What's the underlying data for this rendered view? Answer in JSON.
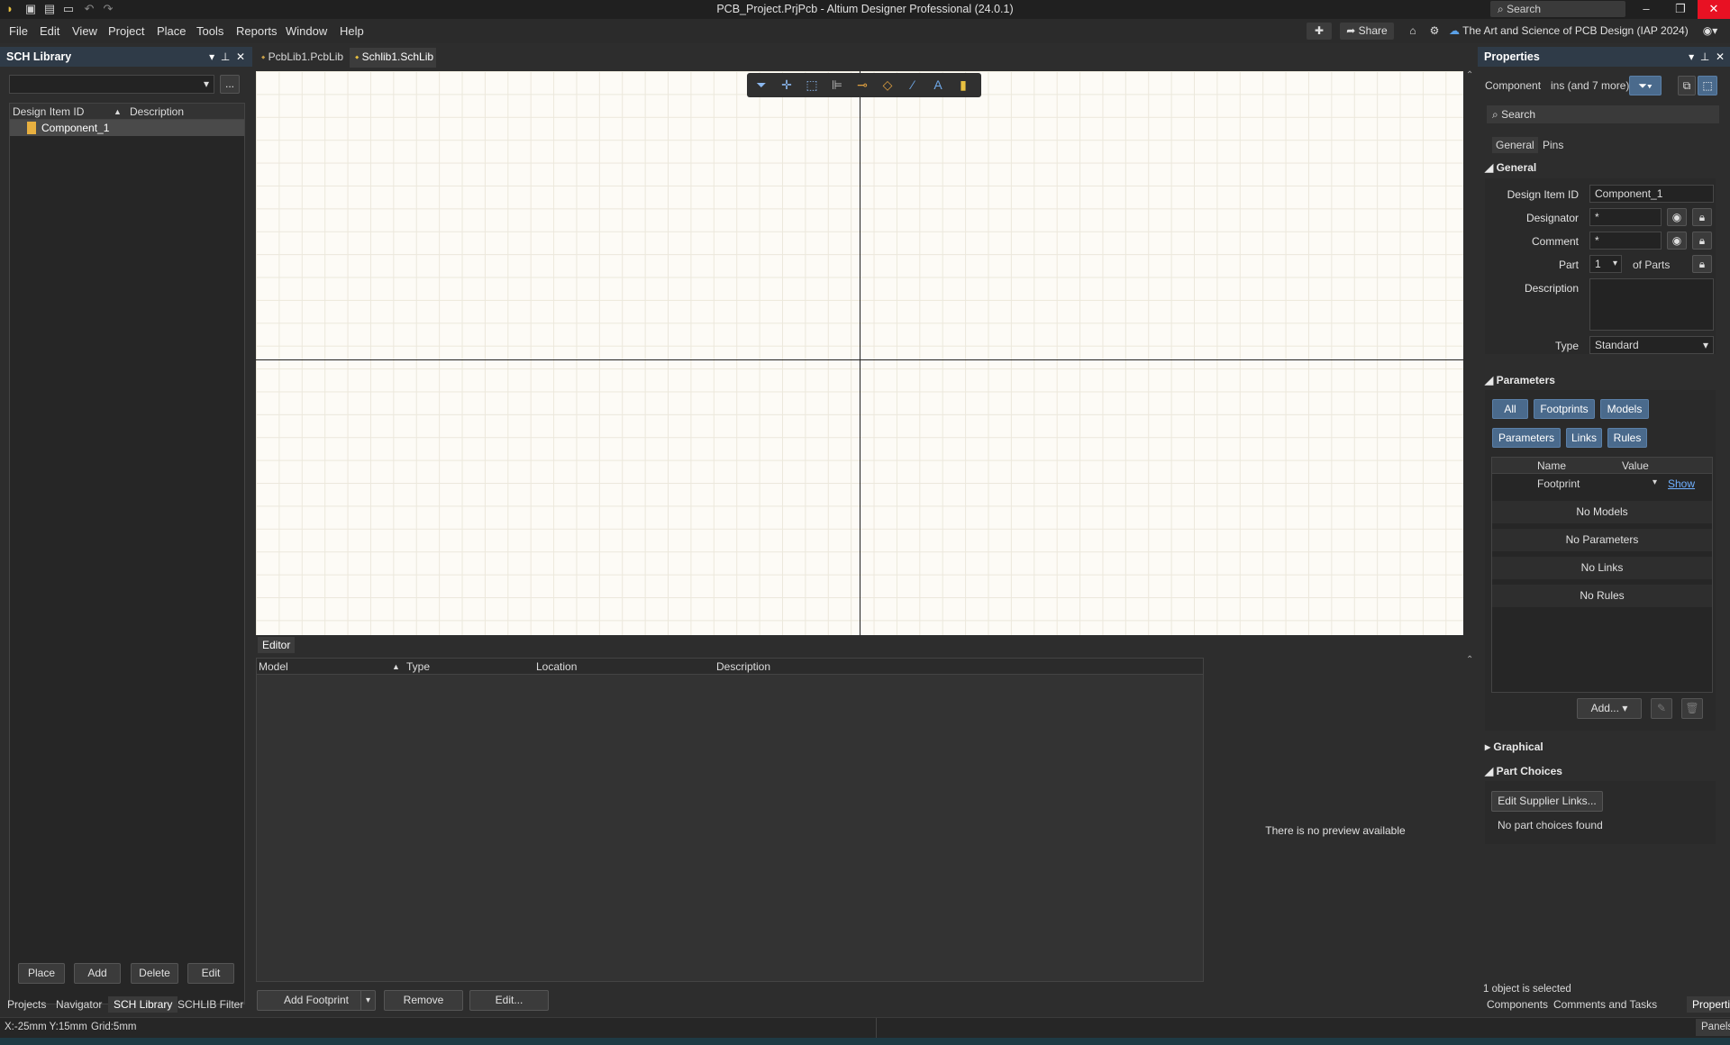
{
  "window": {
    "title": "PCB_Project.PrjPcb - Altium Designer Professional (24.0.1)",
    "search_label": "Search",
    "controls": [
      "–",
      "❐",
      "✕"
    ]
  },
  "menu": [
    "File",
    "Edit",
    "View",
    "Project",
    "Place",
    "Tools",
    "Reports",
    "Window",
    "Help"
  ],
  "top_right": {
    "share_label": "Share",
    "workspace": "The Art and Science of PCB Design (IAP 2024)"
  },
  "doc_tabs": [
    "PcbLib1.PcbLib",
    "Schlib1.SchLib"
  ],
  "left_panel": {
    "title": "SCH Library",
    "filter_button": "...",
    "columns": [
      "Design Item ID",
      "Description"
    ],
    "items": [
      {
        "id": "Component_1",
        "description": ""
      }
    ],
    "buttons": [
      "Place",
      "Add",
      "Delete",
      "Edit"
    ],
    "tabs": [
      "Projects",
      "Navigator",
      "SCH Library",
      "SCHLIB Filter"
    ]
  },
  "editor": {
    "tab": "Editor",
    "columns": [
      "Model",
      "Type",
      "Location",
      "Description"
    ],
    "preview_text": "There is no preview available",
    "buttons": [
      "Add Footprint",
      "Remove",
      "Edit..."
    ]
  },
  "properties": {
    "title": "Properties",
    "filter_label": "Component",
    "filter_value": "ins (and 7 more)",
    "search_placeholder": "Search",
    "tabs": [
      "General",
      "Pins"
    ],
    "general_section": "General",
    "fields": {
      "design_item_id_label": "Design Item ID",
      "design_item_id": "Component_1",
      "designator_label": "Designator",
      "designator": "*",
      "comment_label": "Comment",
      "comment": "*",
      "part_label": "Part",
      "part": "1",
      "of_parts": "of Parts",
      "description_label": "Description",
      "description": "",
      "type_label": "Type",
      "type": "Standard"
    },
    "parameters_section": "Parameters",
    "param_filters_row1": [
      "All",
      "Footprints",
      "Models"
    ],
    "param_filters_row2": [
      "Parameters",
      "Links",
      "Rules"
    ],
    "param_columns": [
      "Name",
      "Value"
    ],
    "param_rows": [
      {
        "name": "Footprint",
        "value": "Show"
      }
    ],
    "empty_rows": [
      "No Models",
      "No Parameters",
      "No Links",
      "No Rules"
    ],
    "add_button": "Add...",
    "graphical_section": "Graphical",
    "part_choices_section": "Part Choices",
    "edit_supplier_links": "Edit Supplier Links...",
    "no_part_choices": "No part choices found",
    "selection_status": "1 object is selected",
    "bottom_tabs": [
      "Components",
      "Comments and Tasks",
      "Properties"
    ]
  },
  "status_bar": {
    "coords": "X:-25mm Y:15mm",
    "grid": "Grid:5mm",
    "panels_button": "Panels"
  },
  "colors": {
    "panel_header": "#2f3b48",
    "canvas_bg": "#fdfbf6",
    "accent_blue": "#4a6a8c",
    "close_red": "#e81123"
  }
}
